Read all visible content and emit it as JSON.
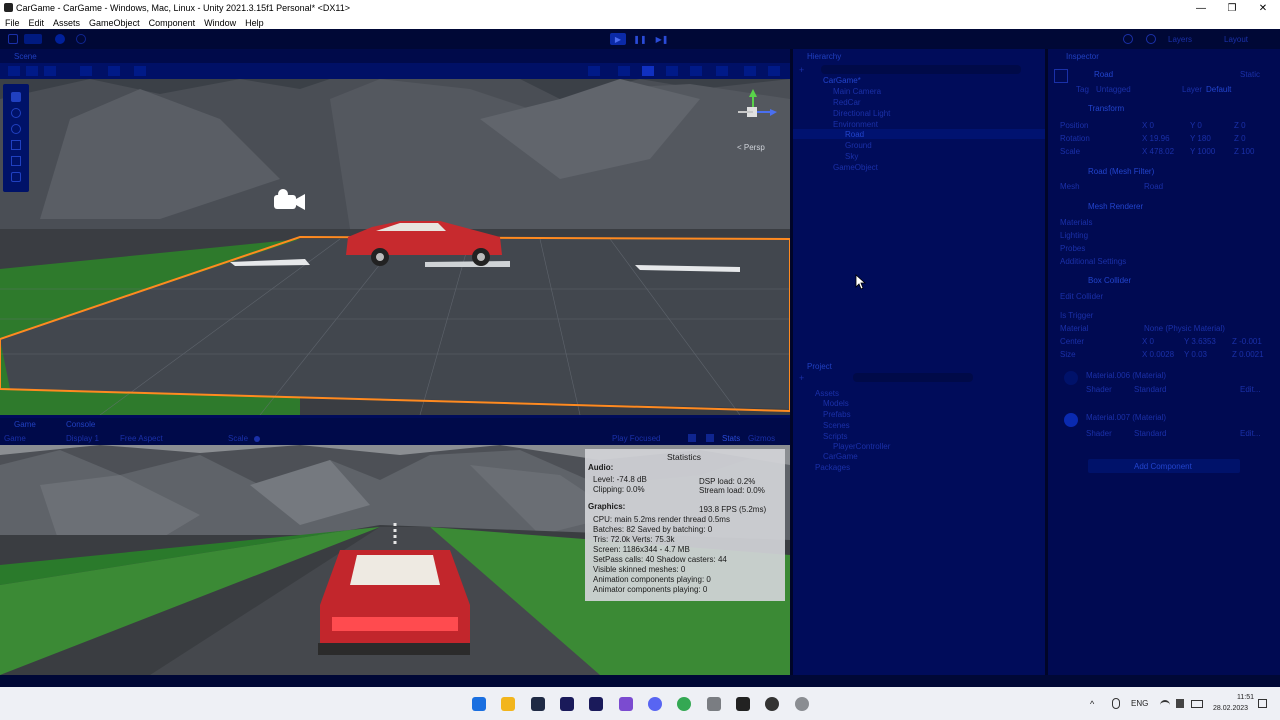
{
  "window": {
    "title": "CarGame - CarGame - Windows, Mac, Linux - Unity 2021.3.15f1 Personal* <DX11>",
    "minimize": "—",
    "maximize": "❐",
    "close": "✕"
  },
  "menu": [
    "File",
    "Edit",
    "Assets",
    "GameObject",
    "Component",
    "Window",
    "Help"
  ],
  "toolbar": {
    "play": "▶",
    "pause": "❚❚",
    "step": "▶❚",
    "layers": "Layers",
    "layout": "Layout"
  },
  "scene": {
    "tab": "Scene",
    "persp_label": "< Persp"
  },
  "game": {
    "tab": "Game",
    "console_tab": "Console",
    "display": "Display 1",
    "aspect": "Free Aspect",
    "scale": "Scale",
    "play_focused": "Play Focused",
    "stats_btn": "Stats",
    "gizmos_btn": "Gizmos"
  },
  "statistics": {
    "title": "Statistics",
    "audio_h": "Audio:",
    "level": "Level: -74.8 dB",
    "clipping": "Clipping: 0.0%",
    "dsp": "DSP load: 0.2%",
    "stream": "Stream load: 0.0%",
    "graphics_h": "Graphics:",
    "fps": "193.8 FPS (5.2ms)",
    "cpu": "CPU: main 5.2ms  render thread 0.5ms",
    "batches": "Batches: 82     Saved by batching: 0",
    "tris": "Tris: 72.0k          Verts: 75.3k",
    "screen": "Screen: 1186x344 - 4.7 MB",
    "setpass": "SetPass calls: 40          Shadow casters: 44",
    "skinned": "Visible skinned meshes: 0",
    "anim": "Animation components playing: 0",
    "animator": "Animator components playing: 0"
  },
  "hierarchy": {
    "tab": "Hierarchy",
    "items": [
      "CarGame*",
      "Main Camera",
      "RedCar",
      "Directional Light",
      "Environment",
      "Road",
      "Ground",
      "Sky",
      "GameObject"
    ]
  },
  "project": {
    "tab": "Project",
    "items": [
      "Assets",
      "Models",
      "Prefabs",
      "Scenes",
      "Scripts",
      "PlayerController",
      "CarGame",
      "Packages"
    ]
  },
  "inspector": {
    "tab": "Inspector",
    "object_name": "Road",
    "static": "Static",
    "tag_label": "Tag",
    "tag_value": "Untagged",
    "layer_label": "Layer",
    "layer_value": "Default",
    "transform": "Transform",
    "position": "Position",
    "rotation": "Rotation",
    "scale": "Scale",
    "pos_vals": [
      "X 0",
      "Y 0",
      "Z 0"
    ],
    "rot_vals": [
      "X 19.96",
      "Y 180",
      "Z 0"
    ],
    "scale_vals": [
      "X 478.02",
      "Y 1000",
      "Z 100"
    ],
    "mesh_filter": "Road (Mesh Filter)",
    "mesh_label": "Mesh",
    "mesh_value": "Road",
    "mesh_renderer": "Mesh Renderer",
    "materials": "Materials",
    "lighting": "Lighting",
    "probes": "Probes",
    "additional": "Additional Settings",
    "box_collider": "Box Collider",
    "edit_collider": "Edit Collider",
    "is_trigger": "Is Trigger",
    "material": "Material",
    "material_value": "None (Physic Material)",
    "center": "Center",
    "size": "Size",
    "center_vals": [
      "X 0",
      "Y 3.6353",
      "Z -0.001"
    ],
    "size_vals": [
      "X 0.0028",
      "Y 0.03",
      "Z 0.0021"
    ],
    "mat1": "Material.006 (Material)",
    "mat2": "Material.007 (Material)",
    "shader_label": "Shader",
    "shader_value": "Standard",
    "edit_btn": "Edit...",
    "add_component": "Add Component"
  },
  "taskbar": {
    "lang": "ENG",
    "time": "11:51",
    "date": "28.02.2023"
  }
}
